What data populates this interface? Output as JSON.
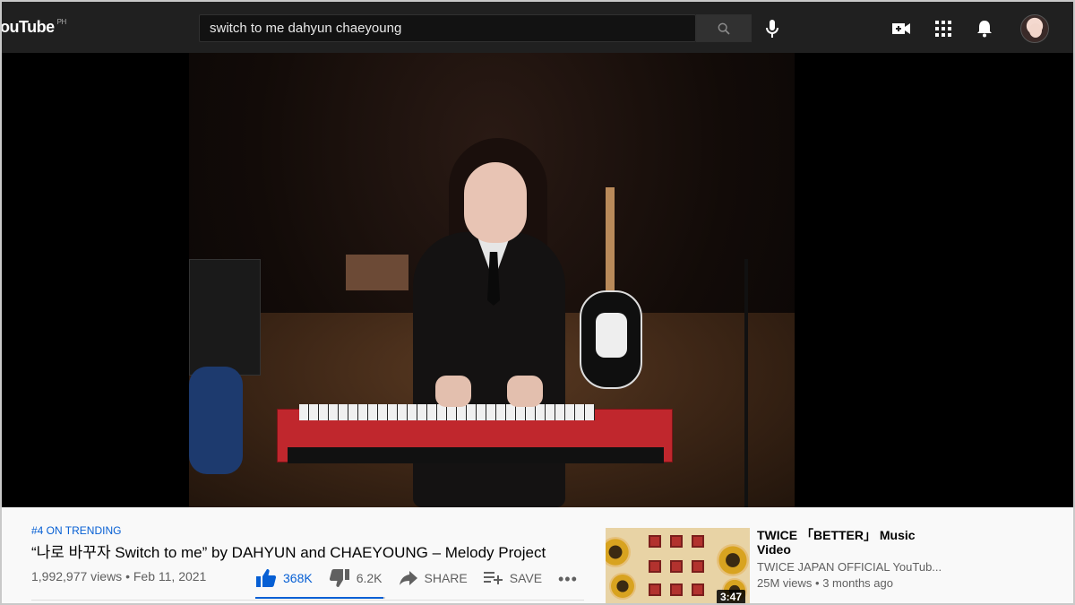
{
  "header": {
    "logo_text": "ouTube",
    "country_code": "PH",
    "search_query": "switch to me dahyun chaeyoung"
  },
  "video": {
    "trending_label": "#4 ON TRENDING",
    "title": "“나로 바꾸자 Switch to me” by DAHYUN and CHAEYOUNG – Melody Project",
    "views": "1,992,977 views",
    "date": "Feb 11, 2021",
    "like_count": "368K",
    "dislike_count": "6.2K",
    "share_label": "SHARE",
    "save_label": "SAVE",
    "like_ratio": 0.983
  },
  "recommendation": {
    "title": "TWICE 「BETTER」 Music Video",
    "channel": "TWICE JAPAN OFFICIAL YouTub...",
    "views": "25M views",
    "age": "3 months ago",
    "duration": "3:47"
  },
  "colors": {
    "topbar": "#202020",
    "accent_blue": "#065fd4"
  }
}
